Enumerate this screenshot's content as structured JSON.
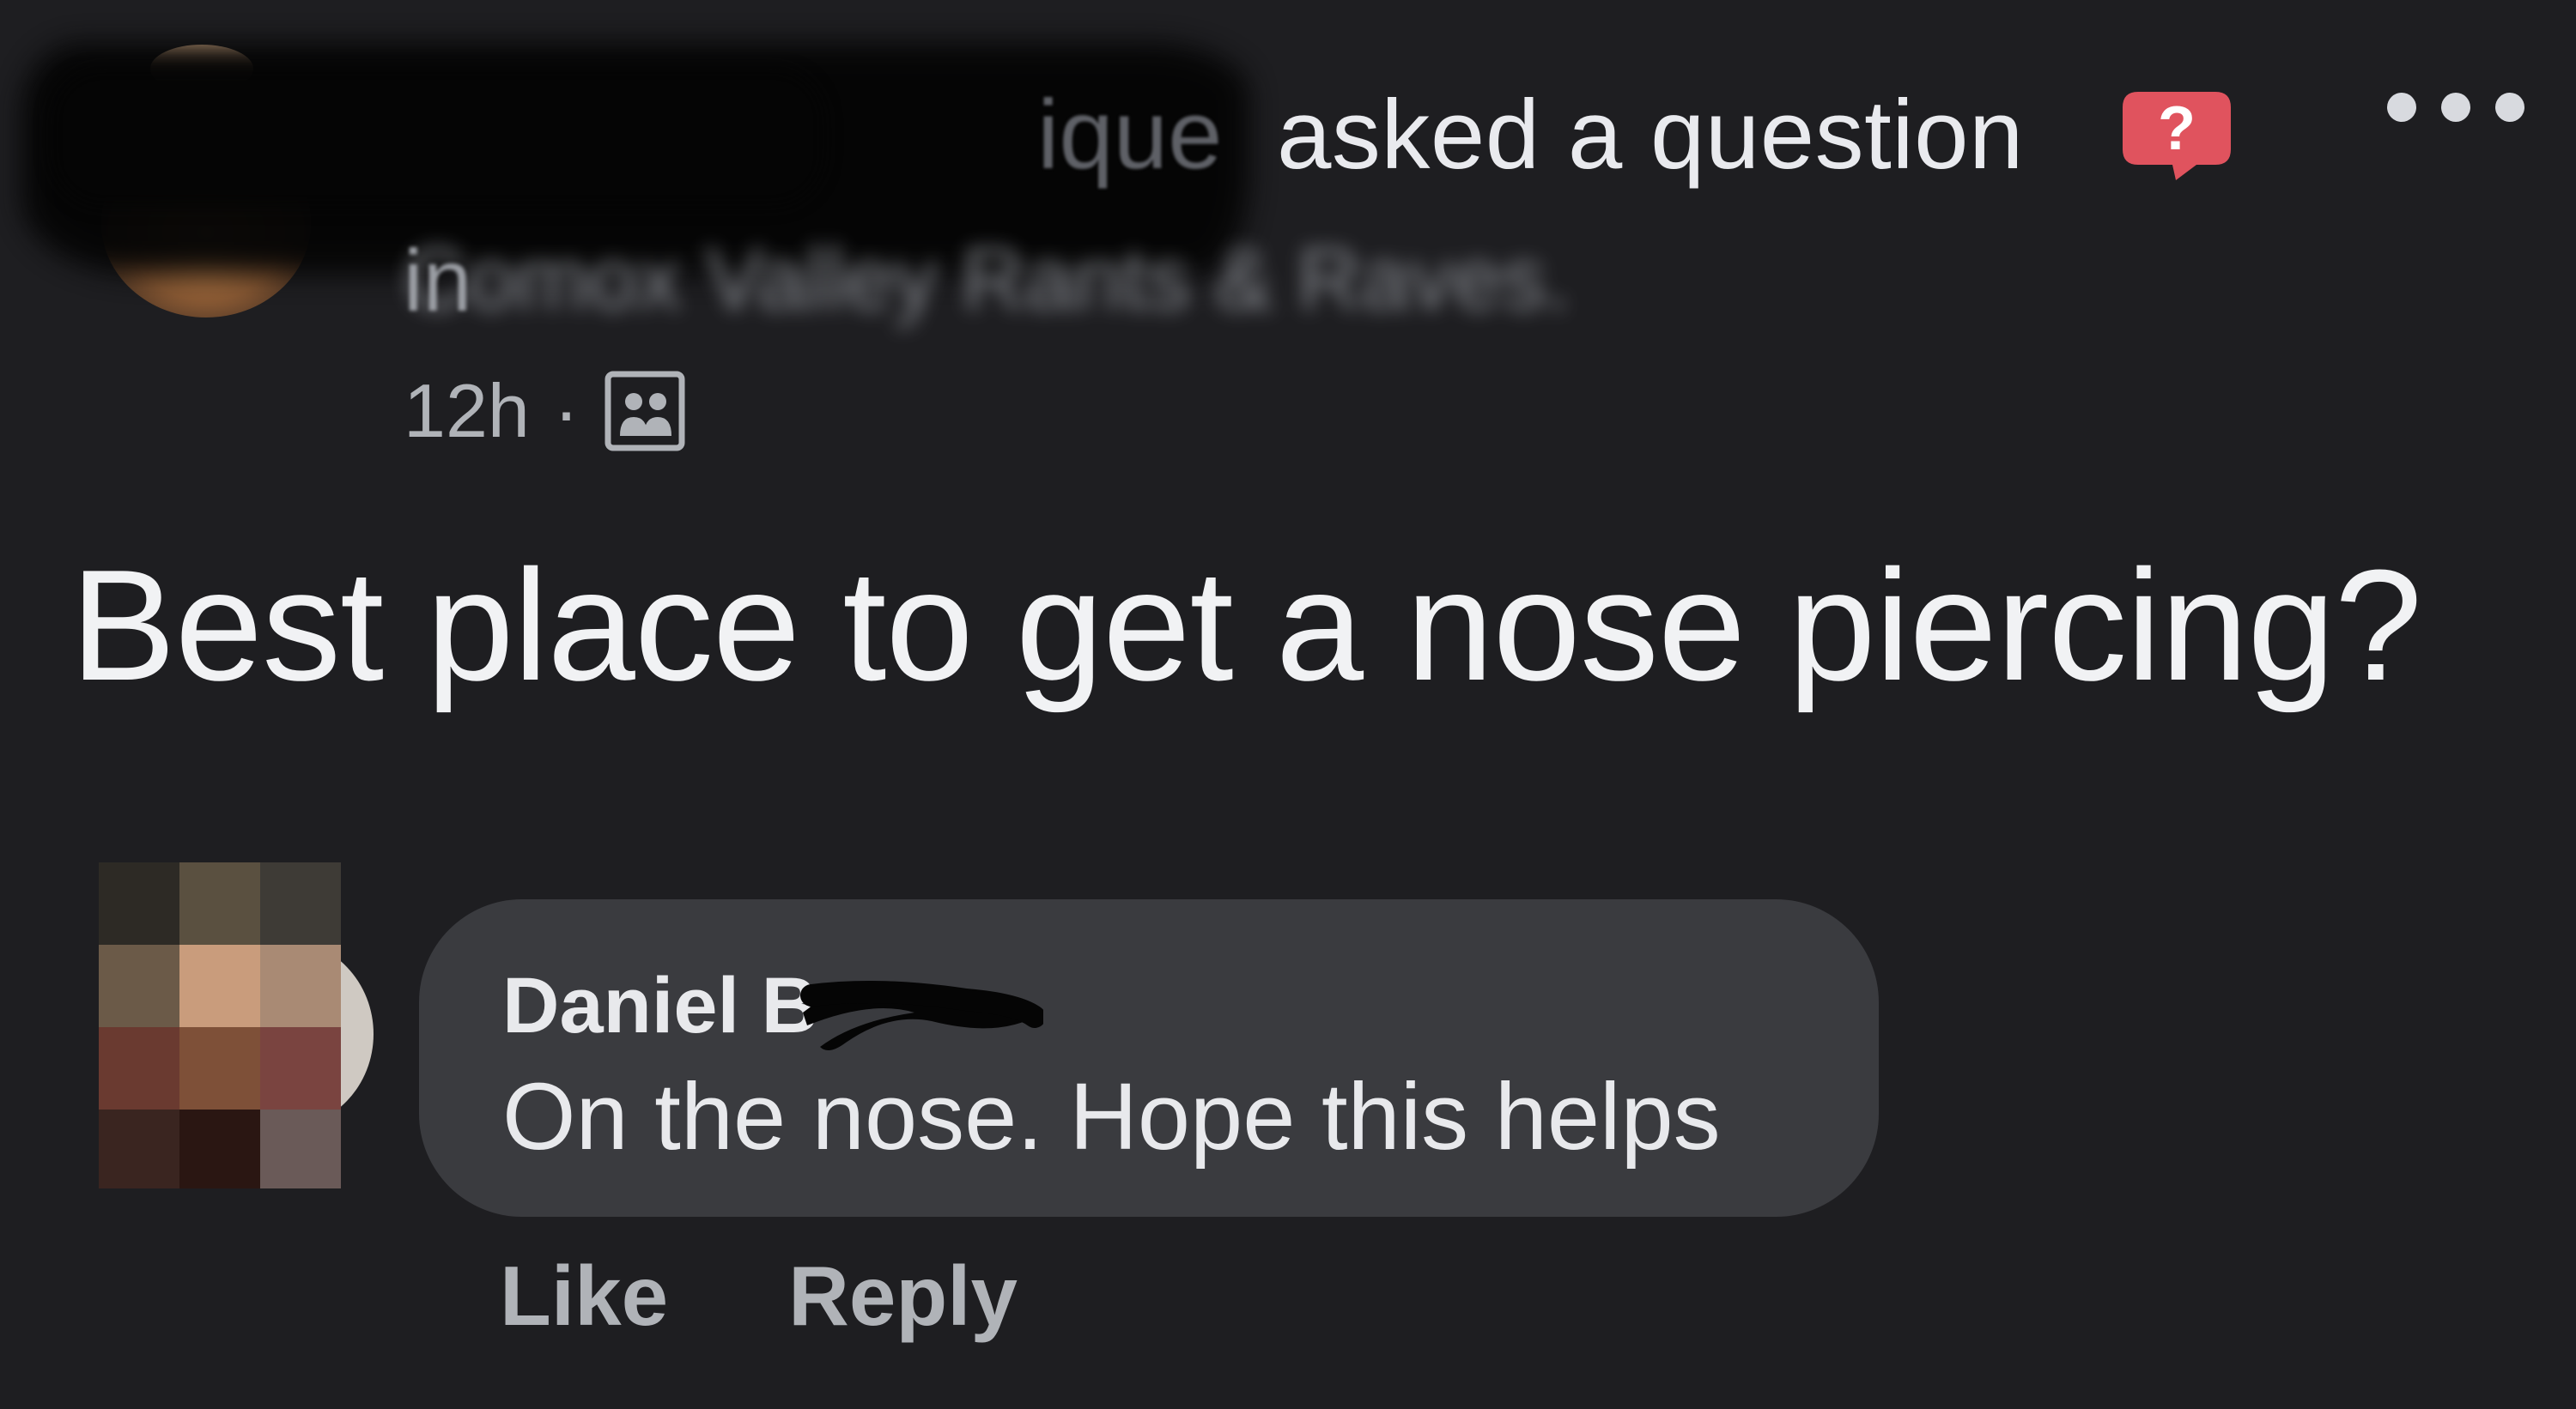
{
  "post": {
    "author_visible_fragment": "ique",
    "action": "asked a question",
    "group_prefix": "in",
    "group_name": "Comox Valley Rants & Raves.",
    "time": "12h",
    "separator": "·",
    "question": "Best place to get a nose piercing?"
  },
  "comment": {
    "author": "Daniel B",
    "text": "On the nose. Hope this helps",
    "like_label": "Like",
    "reply_label": "Reply"
  },
  "icons": {
    "question_badge": "question-badge-icon",
    "more": "more-options-icon",
    "audience": "group-members-icon"
  },
  "colors": {
    "background": "#1e1e21",
    "bubble": "#3a3b3f",
    "badge": "#e0535e"
  }
}
